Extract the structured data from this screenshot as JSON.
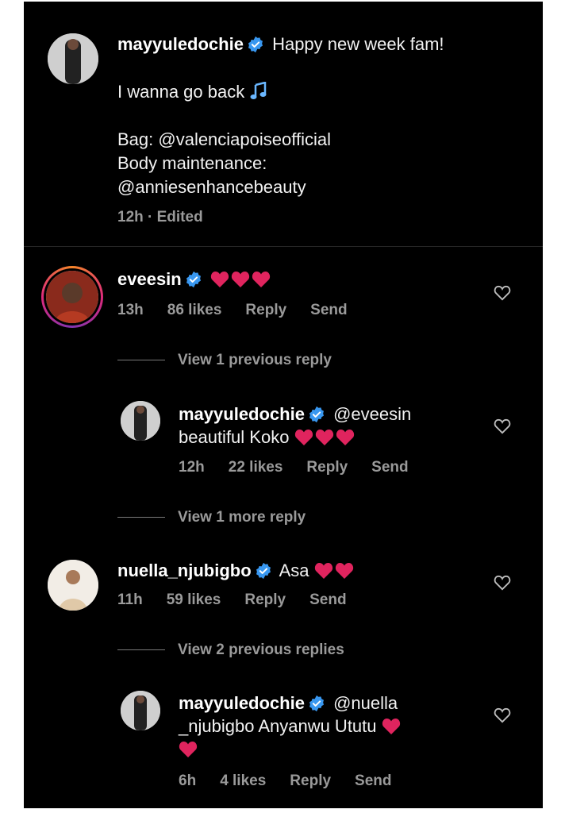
{
  "post": {
    "username": "mayyuledochie",
    "caption_first": "Happy new week fam!",
    "caption_line2": "I wanna go back",
    "caption_line2_emoji": "🎶",
    "caption_line3": "Bag: @valenciapoiseofficial",
    "caption_line4": "Body maintenance:",
    "caption_line5": "@anniesenhancebeauty",
    "meta": "12h · Edited"
  },
  "comments": [
    {
      "username": "eveesin",
      "text": "",
      "hearts": 3,
      "time": "13h",
      "likes": "86 likes",
      "reply": "Reply",
      "send": "Send"
    },
    {
      "view_replies": "View 1 previous reply"
    },
    {
      "username": "mayyuledochie",
      "text": "@eveesin",
      "text2": "beautiful Koko",
      "hearts": 3,
      "time": "12h",
      "likes": "22 likes",
      "reply": "Reply",
      "send": "Send"
    },
    {
      "view_replies": "View 1 more reply"
    },
    {
      "username": "nuella_njubigbo",
      "text": "Asa",
      "hearts": 2,
      "time": "11h",
      "likes": "59 likes",
      "reply": "Reply",
      "send": "Send"
    },
    {
      "view_replies": "View 2 previous replies"
    },
    {
      "username": "mayyuledochie",
      "text": "@nuella",
      "text2": "_njubigbo Anyanwu Ututu",
      "hearts": 2,
      "time": "6h",
      "likes": "4 likes",
      "reply": "Reply",
      "send": "Send"
    }
  ],
  "icons": {
    "verified": "verified-badge-icon",
    "heart_emoji": "red-heart-emoji",
    "like": "heart-outline-icon",
    "music": "musical-notes-emoji"
  },
  "colors": {
    "background": "#000000",
    "verified": "#3897f0",
    "heart": "#e0245e",
    "muted_text": "#9a9a9a"
  }
}
